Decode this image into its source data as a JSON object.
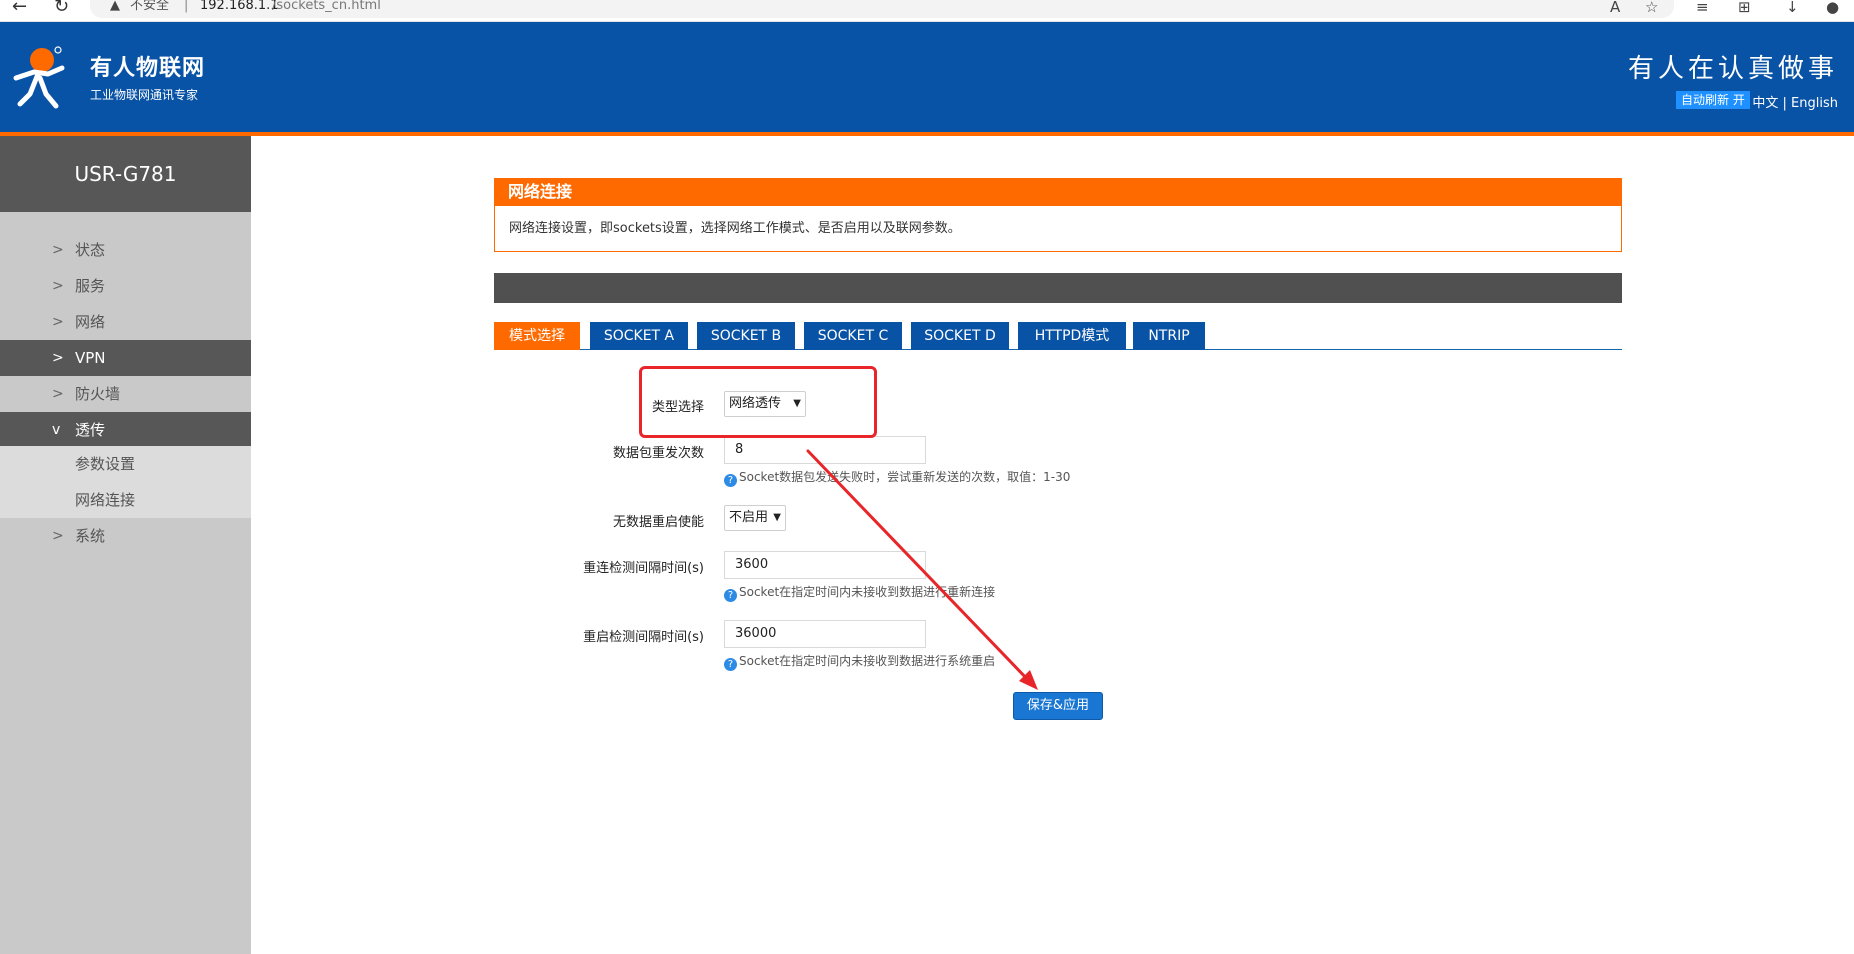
{
  "browser": {
    "insecure_label": "不安全",
    "separator": "|",
    "url_host": "192.168.1.1",
    "url_path": "/sockets_cn.html"
  },
  "header": {
    "brand_name": "有人物联网",
    "brand_tagline": "工业物联网通讯专家",
    "slogan": "有人在认真做事",
    "auto_refresh": "自动刷新 开",
    "lang_cn": "中文",
    "lang_sep": "|",
    "lang_en": "English"
  },
  "sidebar": {
    "model": "USR-G781",
    "items": [
      {
        "label": "状态"
      },
      {
        "label": "服务"
      },
      {
        "label": "网络"
      },
      {
        "label": "VPN"
      },
      {
        "label": "防火墙"
      },
      {
        "label": "透传"
      },
      {
        "label": "系统"
      }
    ],
    "subitems": [
      {
        "label": "参数设置"
      },
      {
        "label": "网络连接"
      }
    ]
  },
  "section": {
    "title": "网络连接",
    "description": "网络连接设置，即sockets设置，选择网络工作模式、是否启用以及联网参数。"
  },
  "tabs": [
    {
      "label": "模式选择"
    },
    {
      "label": "SOCKET A"
    },
    {
      "label": "SOCKET B"
    },
    {
      "label": "SOCKET C"
    },
    {
      "label": "SOCKET D"
    },
    {
      "label": "HTTPD模式"
    },
    {
      "label": "NTRIP"
    }
  ],
  "form": {
    "type_label": "类型选择",
    "type_value": "网络透传",
    "retry_label": "数据包重发次数",
    "retry_value": "8",
    "retry_hint": "Socket数据包发送失败时，尝试重新发送的次数，取值：1-30",
    "norestart_label": "无数据重启使能",
    "norestart_value": "不启用",
    "reconnect_label": "重连检测间隔时间(s)",
    "reconnect_value": "3600",
    "reconnect_hint": "Socket在指定时间内未接收到数据进行重新连接",
    "reboot_label": "重启检测间隔时间(s)",
    "reboot_value": "36000",
    "reboot_hint": "Socket在指定时间内未接收到数据进行系统重启",
    "hint_mark": "?",
    "save_label": "保存&应用"
  },
  "colors": {
    "header_blue": "#0953a6",
    "accent_orange": "#ff6a00",
    "annotation_red": "#e8262a",
    "button_blue": "#1976d2"
  }
}
